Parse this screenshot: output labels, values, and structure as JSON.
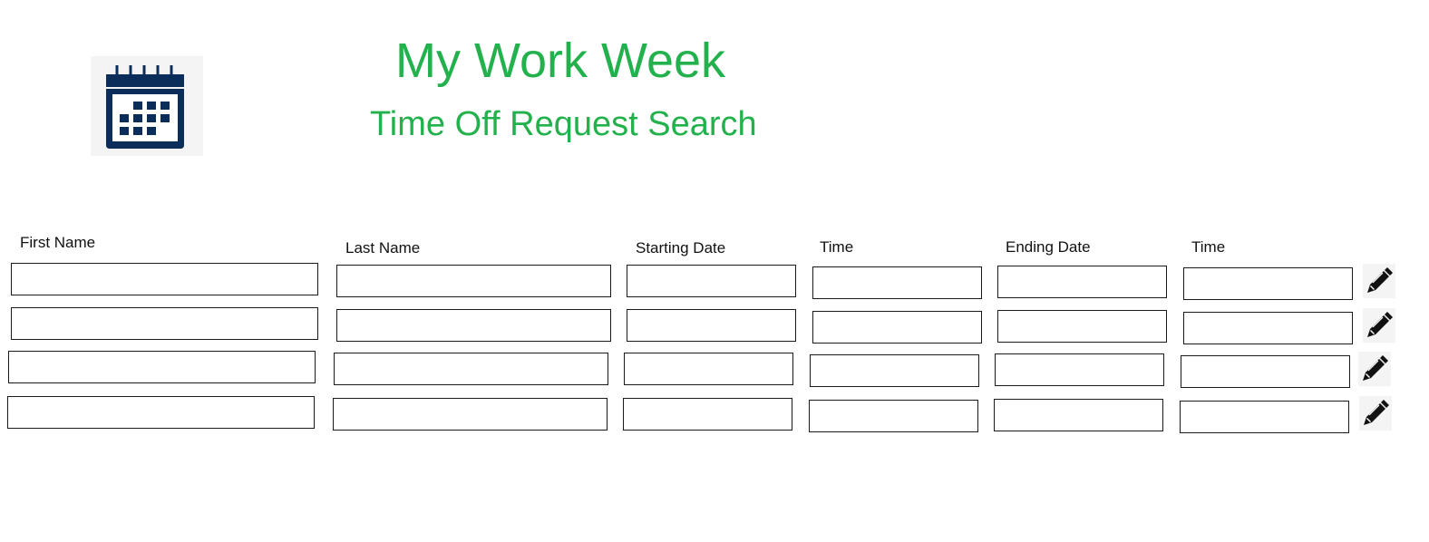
{
  "header": {
    "app_title": "My Work Week",
    "page_title": "Time Off Request Search",
    "logo_icon": "calendar-icon"
  },
  "colors": {
    "title_green": "#22b14c",
    "icon_navy": "#0b2d5a"
  },
  "columns": [
    {
      "key": "first_name",
      "label": "First Name"
    },
    {
      "key": "last_name",
      "label": "Last Name"
    },
    {
      "key": "starting_date",
      "label": "Starting Date"
    },
    {
      "key": "start_time",
      "label": "Time"
    },
    {
      "key": "ending_date",
      "label": "Ending Date"
    },
    {
      "key": "end_time",
      "label": "Time"
    }
  ],
  "rows": [
    {
      "first_name": "",
      "last_name": "",
      "starting_date": "",
      "start_time": "",
      "ending_date": "",
      "end_time": "",
      "action_icon": "pencil-icon"
    },
    {
      "first_name": "",
      "last_name": "",
      "starting_date": "",
      "start_time": "",
      "ending_date": "",
      "end_time": "",
      "action_icon": "pencil-icon"
    },
    {
      "first_name": "",
      "last_name": "",
      "starting_date": "",
      "start_time": "",
      "ending_date": "",
      "end_time": "",
      "action_icon": "pencil-icon"
    },
    {
      "first_name": "",
      "last_name": "",
      "starting_date": "",
      "start_time": "",
      "ending_date": "",
      "end_time": "",
      "action_icon": "pencil-icon"
    }
  ]
}
